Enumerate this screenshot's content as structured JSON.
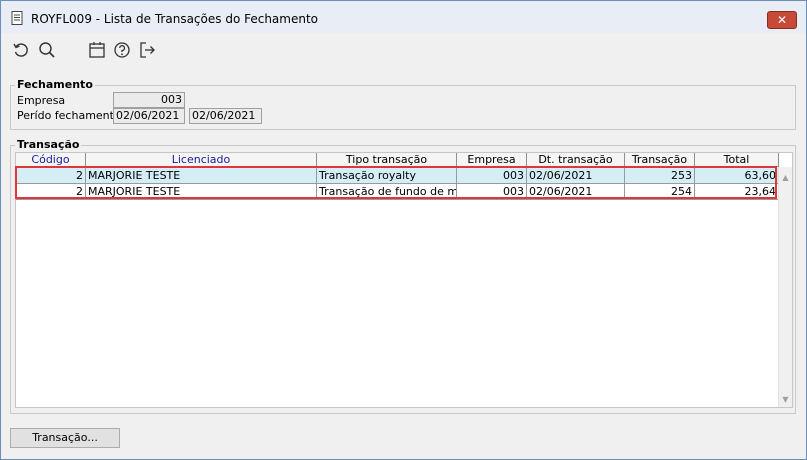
{
  "window": {
    "title": "ROYFL009 - Lista de Transações do Fechamento",
    "close_glyph": "✕"
  },
  "toolbar": {
    "icons": [
      "refresh-icon",
      "search-icon",
      "calendar-icon",
      "help-icon",
      "exit-icon"
    ]
  },
  "fechamento": {
    "group_label": "Fechamento",
    "empresa_label": "Empresa",
    "empresa_value": "003",
    "periodo_label": "Perído fechamento",
    "periodo_start": "02/06/2021",
    "periodo_end": "02/06/2021"
  },
  "transacao": {
    "group_label": "Transação",
    "columns": [
      "Código",
      "Licenciado",
      "Tipo transação",
      "Empresa",
      "Dt. transação",
      "Transação",
      "Total"
    ],
    "rows": [
      {
        "codigo": "2",
        "licenciado": "MARJORIE TESTE",
        "tipo": "Transação royalty",
        "empresa": "003",
        "dt": "02/06/2021",
        "transacao": "253",
        "total": "63,60"
      },
      {
        "codigo": "2",
        "licenciado": "MARJORIE TESTE",
        "tipo": "Transação de fundo de mar",
        "empresa": "003",
        "dt": "02/06/2021",
        "transacao": "254",
        "total": "23,64"
      }
    ]
  },
  "buttons": {
    "transacao_label": "Transação..."
  },
  "colors": {
    "selected_row": "#d5eef6",
    "highlight_border": "#e0353a",
    "close_button": "#c74a38"
  }
}
